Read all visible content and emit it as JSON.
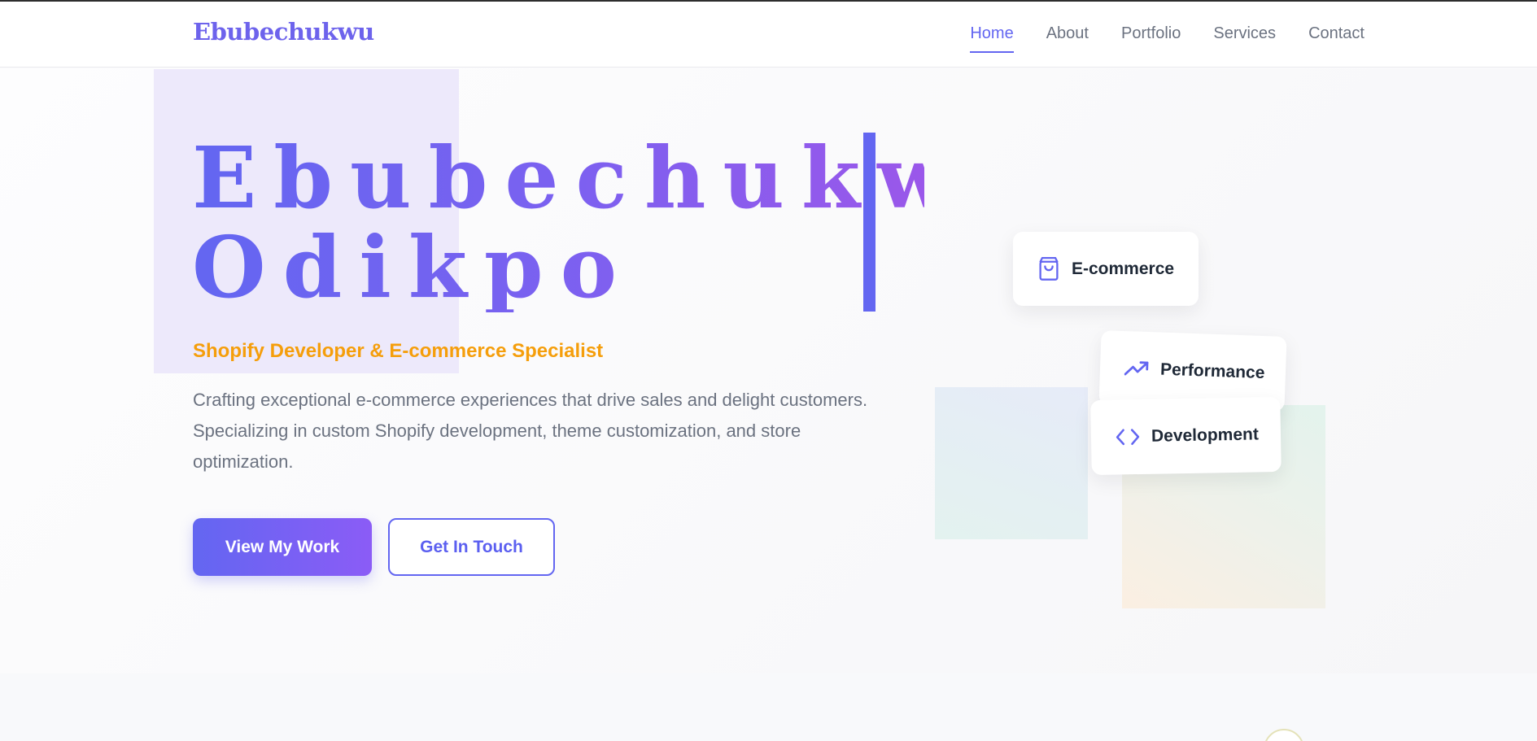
{
  "nav": {
    "brand": "Ebubechukwu",
    "links": [
      "Home",
      "About",
      "Portfolio",
      "Services",
      "Contact"
    ],
    "active": "Home"
  },
  "hero": {
    "name_line1": "Ebubechukwu",
    "name_line2": "Odikpo",
    "subtitle": "Shopify Developer & E-commerce Specialist",
    "description": "Crafting exceptional e-commerce experiences that drive sales and delight customers. Specializing in custom Shopify development, theme customization, and store optimization.",
    "primary_button": "View My Work",
    "secondary_button": "Get In Touch"
  },
  "cards": [
    {
      "label": "E-commerce",
      "icon": "shopping-bag-icon"
    },
    {
      "label": "Performance",
      "icon": "trending-up-icon"
    },
    {
      "label": "Development",
      "icon": "code-icon"
    }
  ],
  "colors": {
    "accent": "#6366f1",
    "accent_secondary": "#8b5cf6",
    "subtitle": "#f59e0b",
    "text_muted": "#6b7280"
  }
}
